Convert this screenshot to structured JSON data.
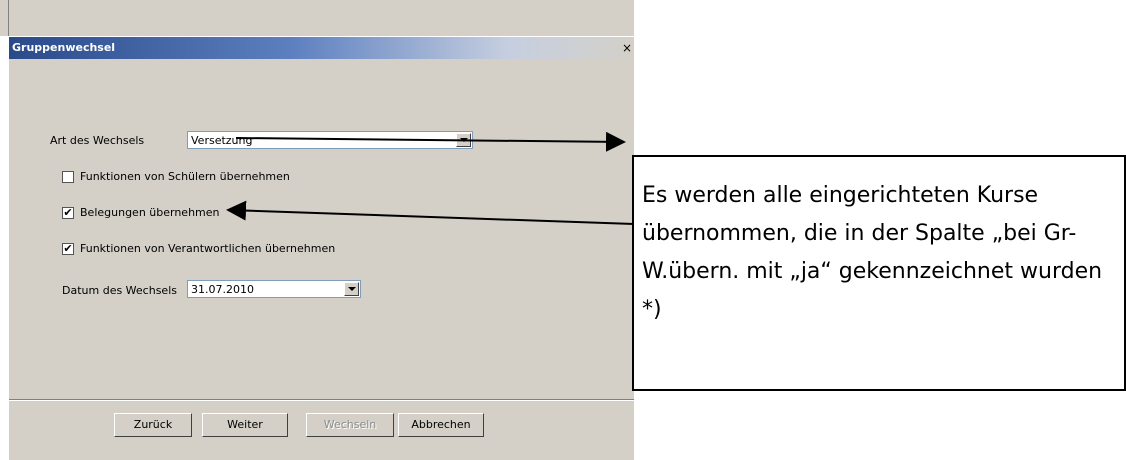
{
  "dialog": {
    "title": "Gruppenwechsel",
    "close_glyph": "×"
  },
  "form": {
    "art_label": "Art des Wechsels",
    "art_value": "Versetzung",
    "opt_funktionen_schueler": {
      "label": "Funktionen von Schülern übernehmen",
      "checked": false
    },
    "opt_belegungen": {
      "label": "Belegungen übernehmen",
      "checked": true
    },
    "opt_funktionen_verantw": {
      "label": "Funktionen von Verantwortlichen übernehmen",
      "checked": true
    },
    "datum_label": "Datum des Wechsels",
    "datum_value": "31.07.2010"
  },
  "buttons": {
    "back": "Zurück",
    "next": "Weiter",
    "switch": "Wechseln",
    "cancel": "Abbrechen"
  },
  "annotation": {
    "text": "Es werden alle eingerichteten Kurse übernommen, die in der Spalte „bei Gr-W.übern. mit „ja“ gekennzeichnet wurden *)"
  },
  "check_glyph": "✔"
}
